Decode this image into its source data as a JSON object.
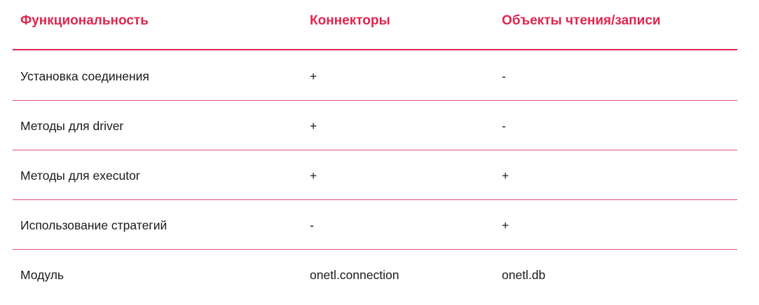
{
  "colors": {
    "accent": "#e0254d",
    "divider": "#d95573",
    "text": "#1a1a1a"
  },
  "table": {
    "headers": [
      "Функциональность",
      "Коннекторы",
      "Объекты чтения/записи"
    ],
    "rows": [
      [
        "Установка соединения",
        "+",
        "-"
      ],
      [
        "Методы для driver",
        "+",
        "-"
      ],
      [
        "Методы для executor",
        "+",
        "+"
      ],
      [
        "Использование стратегий",
        "-",
        "+"
      ],
      [
        "Модуль",
        "onetl.connection",
        "onetl.db"
      ]
    ]
  }
}
